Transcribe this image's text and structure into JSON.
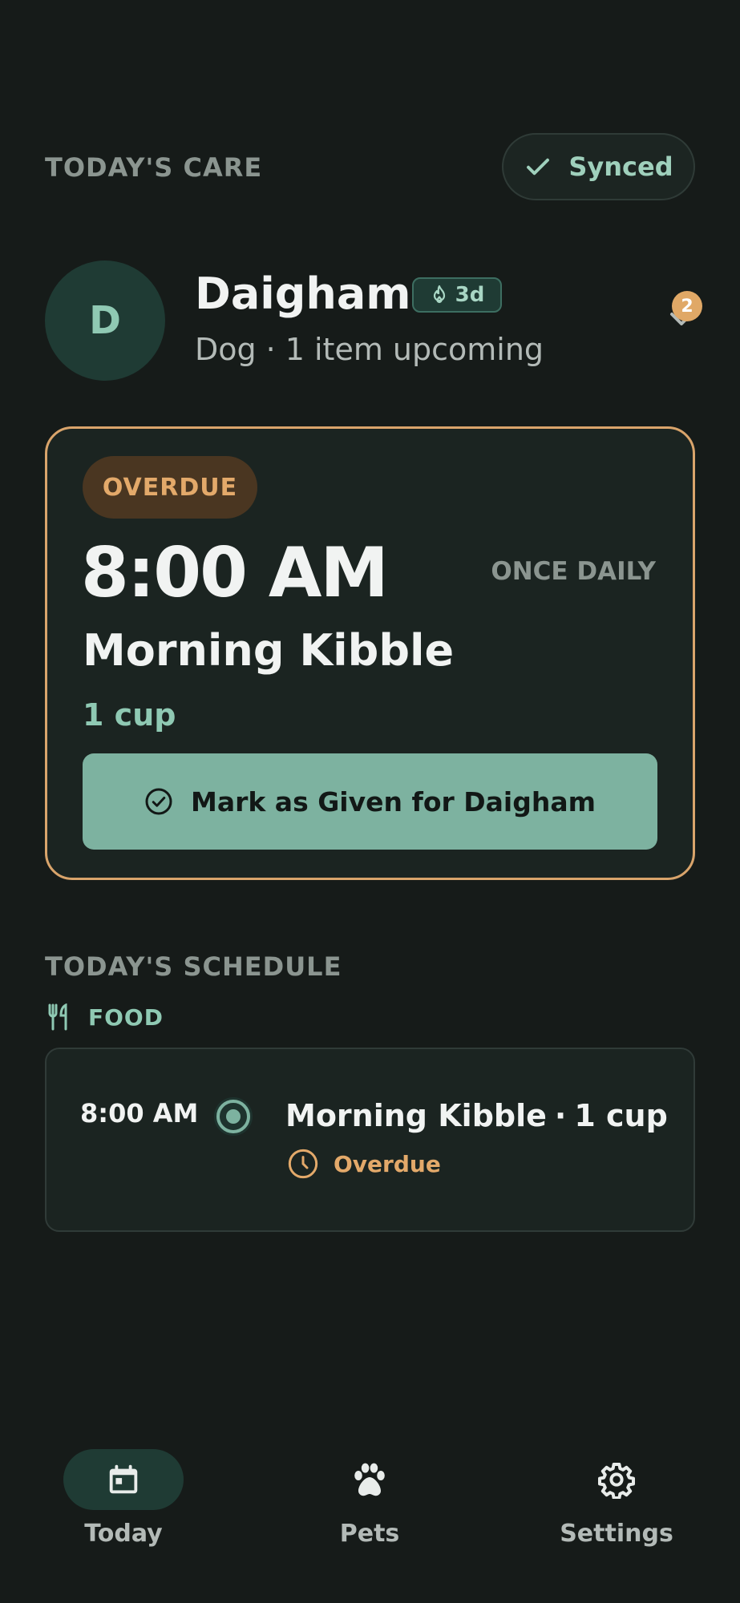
{
  "header": {
    "section_label": "TODAY'S CARE",
    "sync_status": "Synced"
  },
  "pet": {
    "avatar_initial": "D",
    "name": "Daigham",
    "streak": "3d",
    "species": "Dog",
    "upcoming": "1 item upcoming",
    "notification_count": "2"
  },
  "due_card": {
    "status": "OVERDUE",
    "time": "8:00 AM",
    "frequency": "ONCE DAILY",
    "title": "Morning Kibble",
    "amount": "1 cup",
    "action_label": "Mark as Given for Daigham"
  },
  "schedule": {
    "section_label": "TODAY'S SCHEDULE",
    "category": "FOOD",
    "items": [
      {
        "time": "8:00 AM",
        "title": "Morning Kibble",
        "amount": "1 cup",
        "status": "Overdue"
      }
    ]
  },
  "nav": {
    "items": [
      {
        "label": "Today",
        "icon": "calendar-icon",
        "active": true
      },
      {
        "label": "Pets",
        "icon": "paw-icon",
        "active": false
      },
      {
        "label": "Settings",
        "icon": "gear-icon",
        "active": false
      }
    ]
  },
  "colors": {
    "background": "#161b19",
    "accent_teal": "#7db2a0",
    "overdue_orange": "#e3a96a",
    "card": "#1b2421"
  }
}
